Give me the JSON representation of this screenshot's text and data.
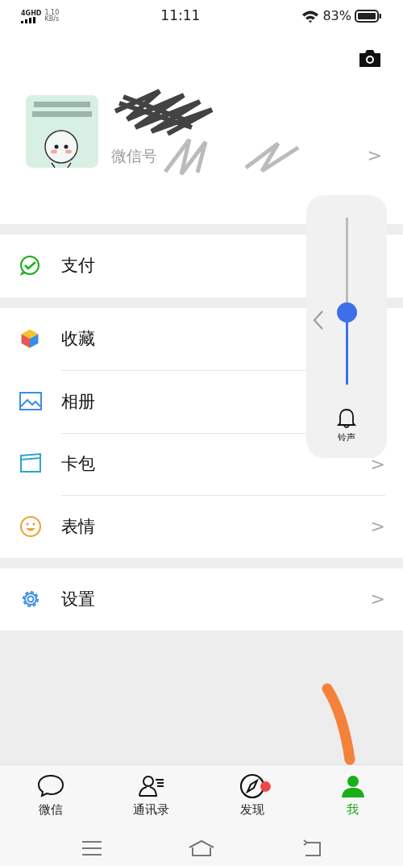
{
  "status_bar": {
    "network": "4GHD",
    "speed": "1.10",
    "speed_unit": "KB/s",
    "time": "11:11",
    "battery_text": "83%"
  },
  "profile": {
    "wechat_id_label": "微信号",
    "arrow": ">"
  },
  "menu_groups": [
    [
      {
        "label": "支付"
      }
    ],
    [
      {
        "label": "收藏"
      },
      {
        "label": "相册"
      },
      {
        "label": "卡包",
        "arrow": ">"
      },
      {
        "label": "表情",
        "arrow": ">"
      }
    ],
    [
      {
        "label": "设置",
        "arrow": ">"
      }
    ]
  ],
  "volume_panel": {
    "level": 0.43,
    "label": "铃声"
  },
  "tabs": [
    {
      "label": "微信",
      "selected": false,
      "badge": false
    },
    {
      "label": "通讯录",
      "selected": false,
      "badge": false
    },
    {
      "label": "发现",
      "selected": false,
      "badge": true
    },
    {
      "label": "我",
      "selected": true,
      "badge": false
    }
  ]
}
